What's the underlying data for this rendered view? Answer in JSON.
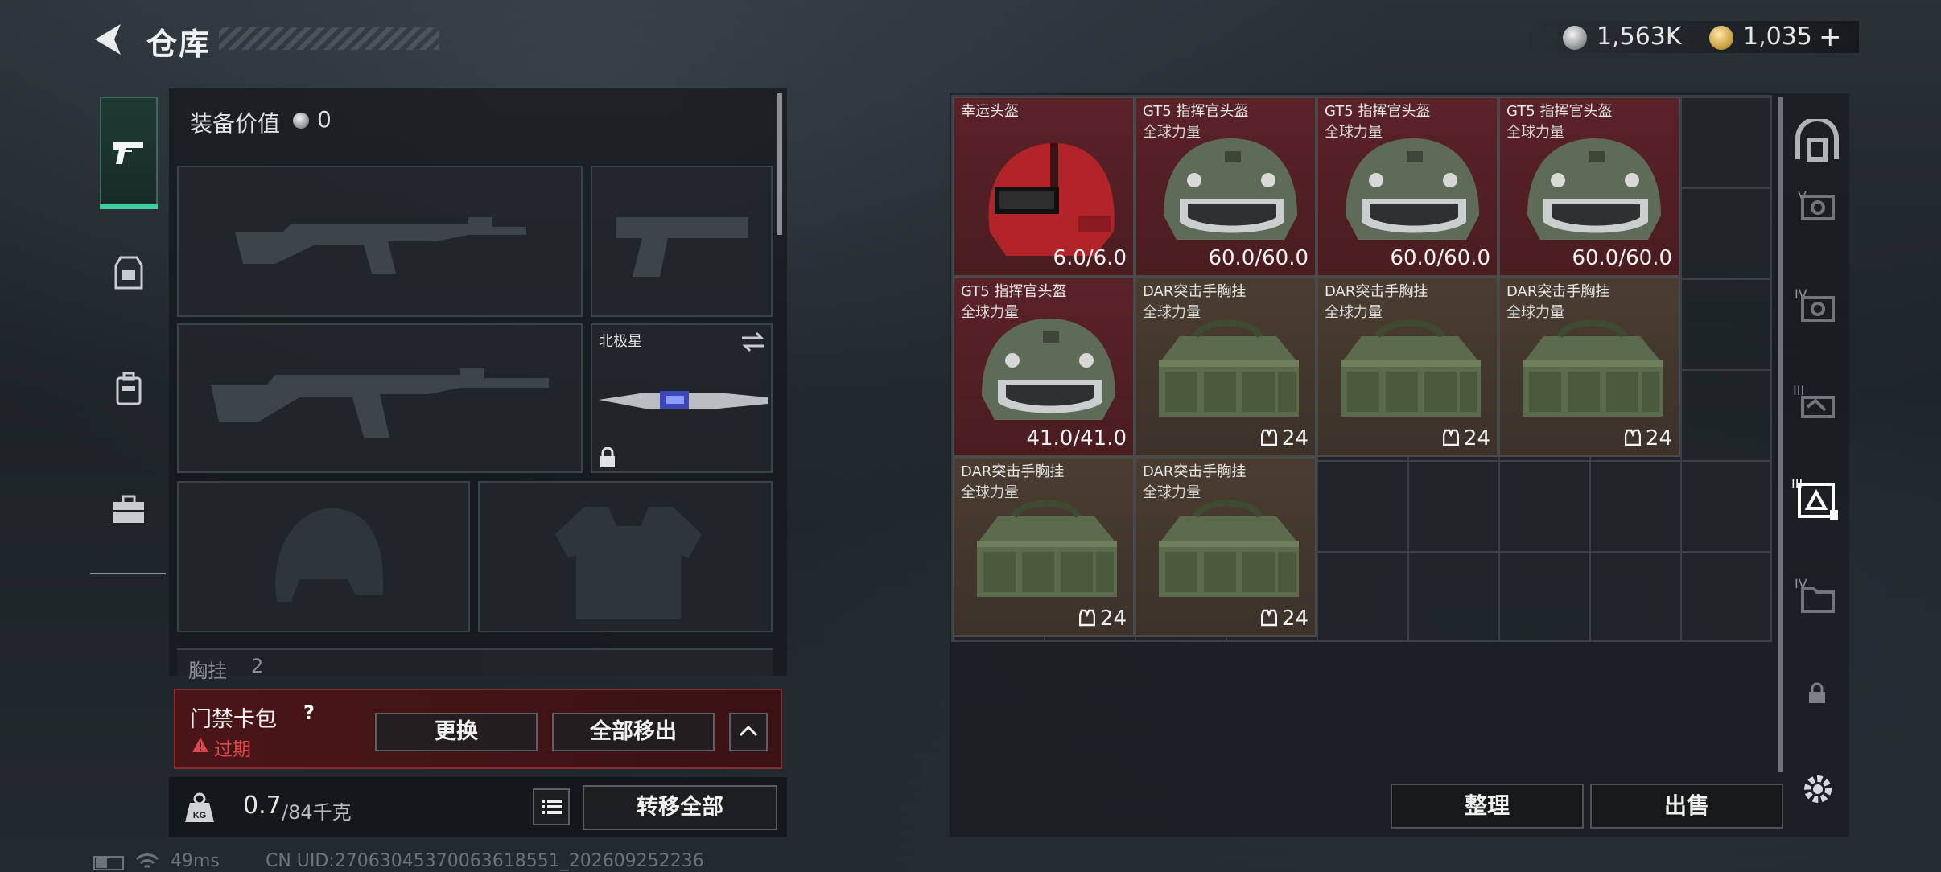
{
  "header": {
    "title": "仓库",
    "currency": [
      {
        "icon": "silver-coin-icon",
        "value": "1,563K"
      },
      {
        "icon": "gold-coin-icon",
        "value": "1,035"
      }
    ],
    "add_label": "+"
  },
  "loadout": {
    "equip_value_label": "装备价值",
    "equip_value": "0",
    "secondary_weapon_name": "北极星",
    "section_label": "胸挂",
    "section_count": "2"
  },
  "access_card": {
    "label": "门禁卡包",
    "help": "?",
    "status": "过期",
    "replace_label": "更换",
    "remove_all_label": "全部移出"
  },
  "capacity": {
    "used": "0.7",
    "total": "/84千克",
    "kg_label": "KG",
    "transfer_all_label": "转移全部"
  },
  "storage": {
    "items": [
      {
        "name": "幸运头盔",
        "sub": "",
        "value": "6.0/6.0",
        "type": "red-helmet",
        "color": "red"
      },
      {
        "name": "GT5 指挥官头盔",
        "sub": "全球力量",
        "value": "60.0/60.0",
        "type": "tactical-helmet",
        "color": "red"
      },
      {
        "name": "GT5 指挥官头盔",
        "sub": "全球力量",
        "value": "60.0/60.0",
        "type": "tactical-helmet",
        "color": "red"
      },
      {
        "name": "GT5 指挥官头盔",
        "sub": "全球力量",
        "value": "60.0/60.0",
        "type": "tactical-helmet",
        "color": "red"
      },
      {
        "name": "GT5 指挥官头盔",
        "sub": "全球力量",
        "value": "41.0/41.0",
        "type": "tactical-helmet",
        "color": "red"
      },
      {
        "name": "DAR突击手胸挂",
        "sub": "全球力量",
        "value": "24",
        "type": "chest-rig",
        "color": "brown"
      },
      {
        "name": "DAR突击手胸挂",
        "sub": "全球力量",
        "value": "24",
        "type": "chest-rig",
        "color": "brown"
      },
      {
        "name": "DAR突击手胸挂",
        "sub": "全球力量",
        "value": "24",
        "type": "chest-rig",
        "color": "brown"
      },
      {
        "name": "DAR突击手胸挂",
        "sub": "全球力量",
        "value": "24",
        "type": "chest-rig",
        "color": "brown"
      },
      {
        "name": "DAR突击手胸挂",
        "sub": "全球力量",
        "value": "24",
        "type": "chest-rig",
        "color": "brown"
      }
    ],
    "sort_label": "整理",
    "sell_label": "出售"
  },
  "side_tabs": {
    "roman_labels": [
      "V",
      "IV",
      "III",
      "III",
      "IV"
    ]
  },
  "status_bar": {
    "ping": "49ms",
    "uid": "CN UID:27063045370063618551_202609252236"
  },
  "colors": {
    "accent_green": "#3fcf9e",
    "warning_red": "#e0474c",
    "item_red": "#5a2228",
    "item_brown": "#4a3d31"
  }
}
